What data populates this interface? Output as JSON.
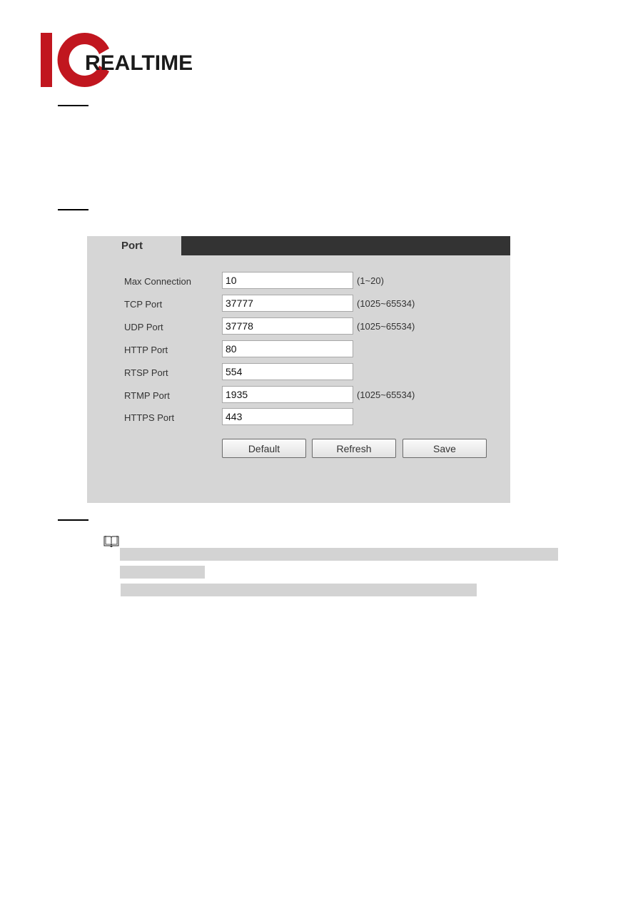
{
  "brand": {
    "logo_mark": "IC",
    "logo_text": "REALTIME",
    "mark_color": "#c1161f",
    "text_color": "#1a1a1a"
  },
  "panel": {
    "tab_label": "Port",
    "fields": [
      {
        "label": "Max Connection",
        "value": "10",
        "hint": "(1~20)"
      },
      {
        "label": "TCP Port",
        "value": "37777",
        "hint": "(1025~65534)"
      },
      {
        "label": "UDP Port",
        "value": "37778",
        "hint": "(1025~65534)"
      },
      {
        "label": "HTTP Port",
        "value": "80",
        "hint": ""
      },
      {
        "label": "RTSP Port",
        "value": "554",
        "hint": ""
      },
      {
        "label": "RTMP Port",
        "value": "1935",
        "hint": "(1025~65534)"
      },
      {
        "label": "HTTPS Port",
        "value": "443",
        "hint": ""
      }
    ],
    "buttons": {
      "default_label": "Default",
      "refresh_label": "Refresh",
      "save_label": "Save"
    }
  },
  "note": {
    "icon": "book-icon"
  }
}
